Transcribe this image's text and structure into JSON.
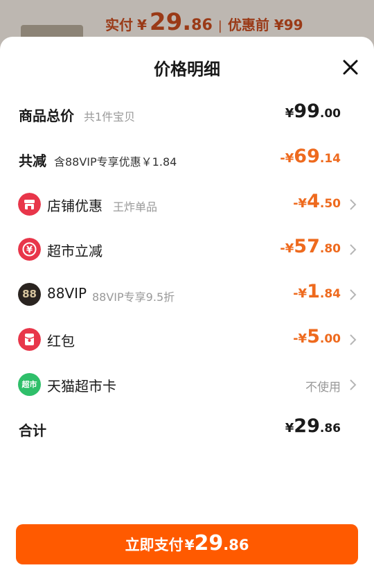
{
  "background": {
    "paid_label": "实付",
    "yen": "¥",
    "paid_int": "29.",
    "paid_dec": "86",
    "separator": "|",
    "before_label": "优惠前 ¥99"
  },
  "sheet": {
    "title": "价格明细",
    "close_icon": "close-icon"
  },
  "rows": {
    "total": {
      "label": "商品总价",
      "sub": "共1件宝贝",
      "sym": "¥",
      "int": "99",
      "dec": ".00"
    },
    "reduce": {
      "label": "共减",
      "sub": "含88VIP专享优惠￥1.84",
      "sym": "-¥",
      "int": "69",
      "dec": ".14"
    },
    "shop": {
      "label": "店铺优惠",
      "sub": "王炸单品",
      "sym": "-¥",
      "int": "4",
      "dec": ".50",
      "icon": "shop-icon",
      "color": "#e8364a"
    },
    "market": {
      "label": "超市立减",
      "sym": "-¥",
      "int": "57",
      "dec": ".80",
      "icon": "yen-coupon-icon",
      "color": "#e8364a"
    },
    "vip": {
      "label": "88VIP",
      "sub": "88VIP专享9.5折",
      "sym": "-¥",
      "int": "1",
      "dec": ".84",
      "icon": "88vip-icon",
      "icon_text": "88",
      "color": "#2a2420"
    },
    "redpacket": {
      "label": "红包",
      "sym": "-¥",
      "int": "5",
      "dec": ".00",
      "icon": "red-packet-icon",
      "color": "#e8364a"
    },
    "card": {
      "label": "天猫超市卡",
      "status": "不使用",
      "icon": "tmall-market-icon",
      "icon_text": "超市",
      "color": "#2fbf6a"
    },
    "sum": {
      "label": "合计",
      "sym": "¥",
      "int": "29",
      "dec": ".86"
    }
  },
  "pay_button": {
    "label": "立即支付",
    "sym": "¥",
    "int": "29",
    "dec": ".86",
    "color": "#ff5a00"
  },
  "colors": {
    "accent": "#ee6a1e",
    "primary_text": "#1a1a1a",
    "muted_text": "#999999"
  }
}
